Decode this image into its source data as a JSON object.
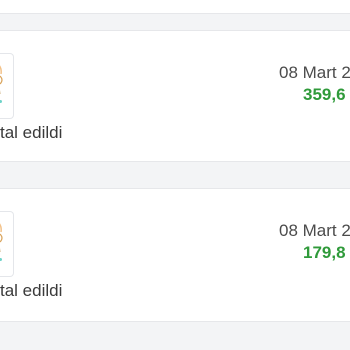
{
  "orders": [
    {
      "date": "08 Mart 2",
      "price": "359,6",
      "status": "tal edildi",
      "thumbnail_icon": "product-thumbnail"
    },
    {
      "date": "08 Mart 2",
      "price": "179,8",
      "status": "tal edildi",
      "thumbnail_icon": "product-thumbnail"
    }
  ],
  "colors": {
    "background": "#f3f4f6",
    "card": "#ffffff",
    "price": "#2f9a3a",
    "status_text": "#3a3a3a",
    "date_text": "#4b4b4b",
    "thumb_accent_teal": "#6fd3c9",
    "thumb_accent_peach": "#f3c28a"
  }
}
